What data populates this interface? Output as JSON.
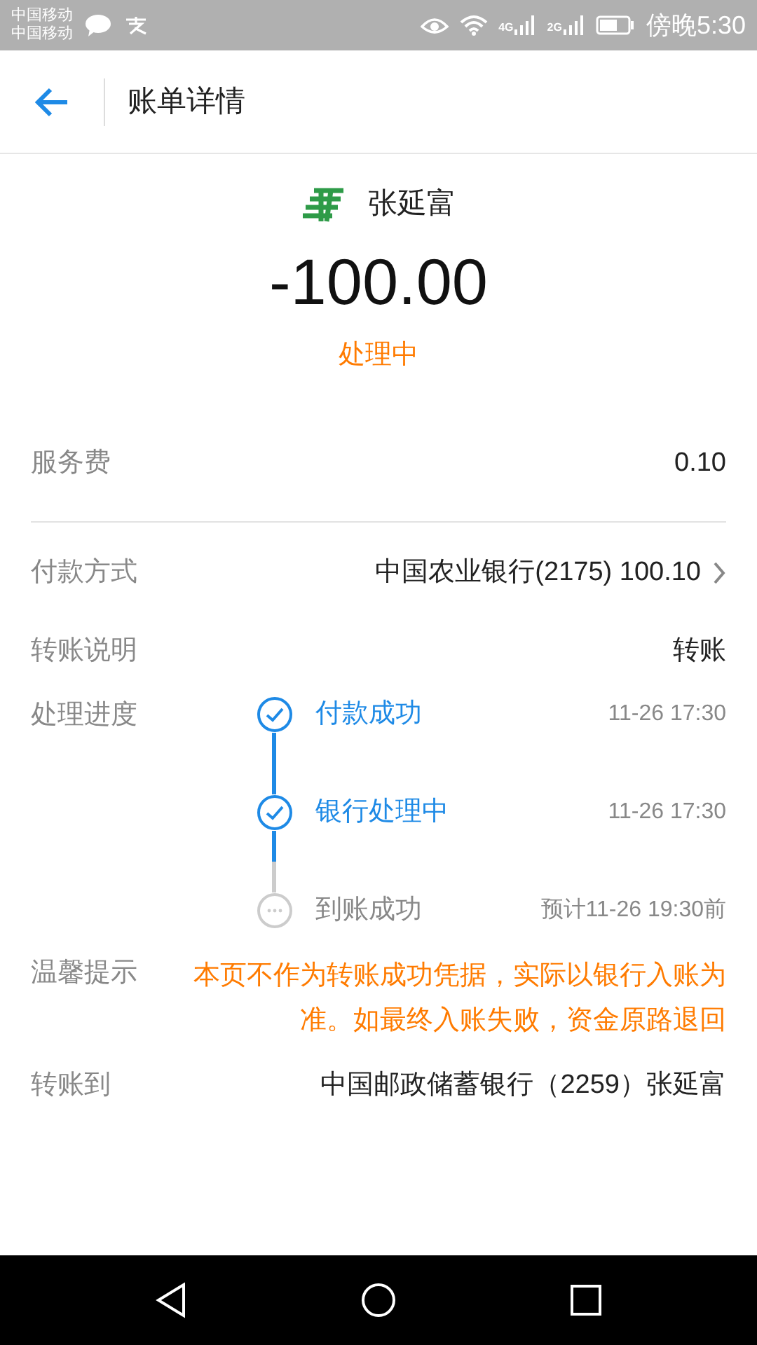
{
  "status_bar": {
    "carriers": [
      "中国移动",
      "中国移动"
    ],
    "time": "傍晚5:30",
    "network_labels": [
      "4G",
      "2G"
    ]
  },
  "header": {
    "title": "账单详情"
  },
  "merchant": {
    "name": "张延富"
  },
  "amount": "-100.00",
  "status": "处理中",
  "fee": {
    "label": "服务费",
    "value": "0.10"
  },
  "details": [
    {
      "kind": "link",
      "label": "付款方式",
      "value": "中国农业银行(2175) 100.10"
    },
    {
      "kind": "text",
      "label": "转账说明",
      "value": "转账"
    }
  ],
  "progress": {
    "label": "处理进度",
    "steps": [
      {
        "title": "付款成功",
        "time": "11-26 17:30",
        "done": true
      },
      {
        "title": "银行处理中",
        "time": "11-26 17:30",
        "done": true
      },
      {
        "title": "到账成功",
        "time": "预计11-26 19:30前",
        "done": false
      }
    ]
  },
  "tip": {
    "label": "温馨提示",
    "text": "本页不作为转账成功凭据，实际以银行入账为准。如最终入账失败，资金原路退回"
  },
  "transfer_to": {
    "label": "转账到",
    "value": "中国邮政储蓄银行（2259）张延富"
  }
}
